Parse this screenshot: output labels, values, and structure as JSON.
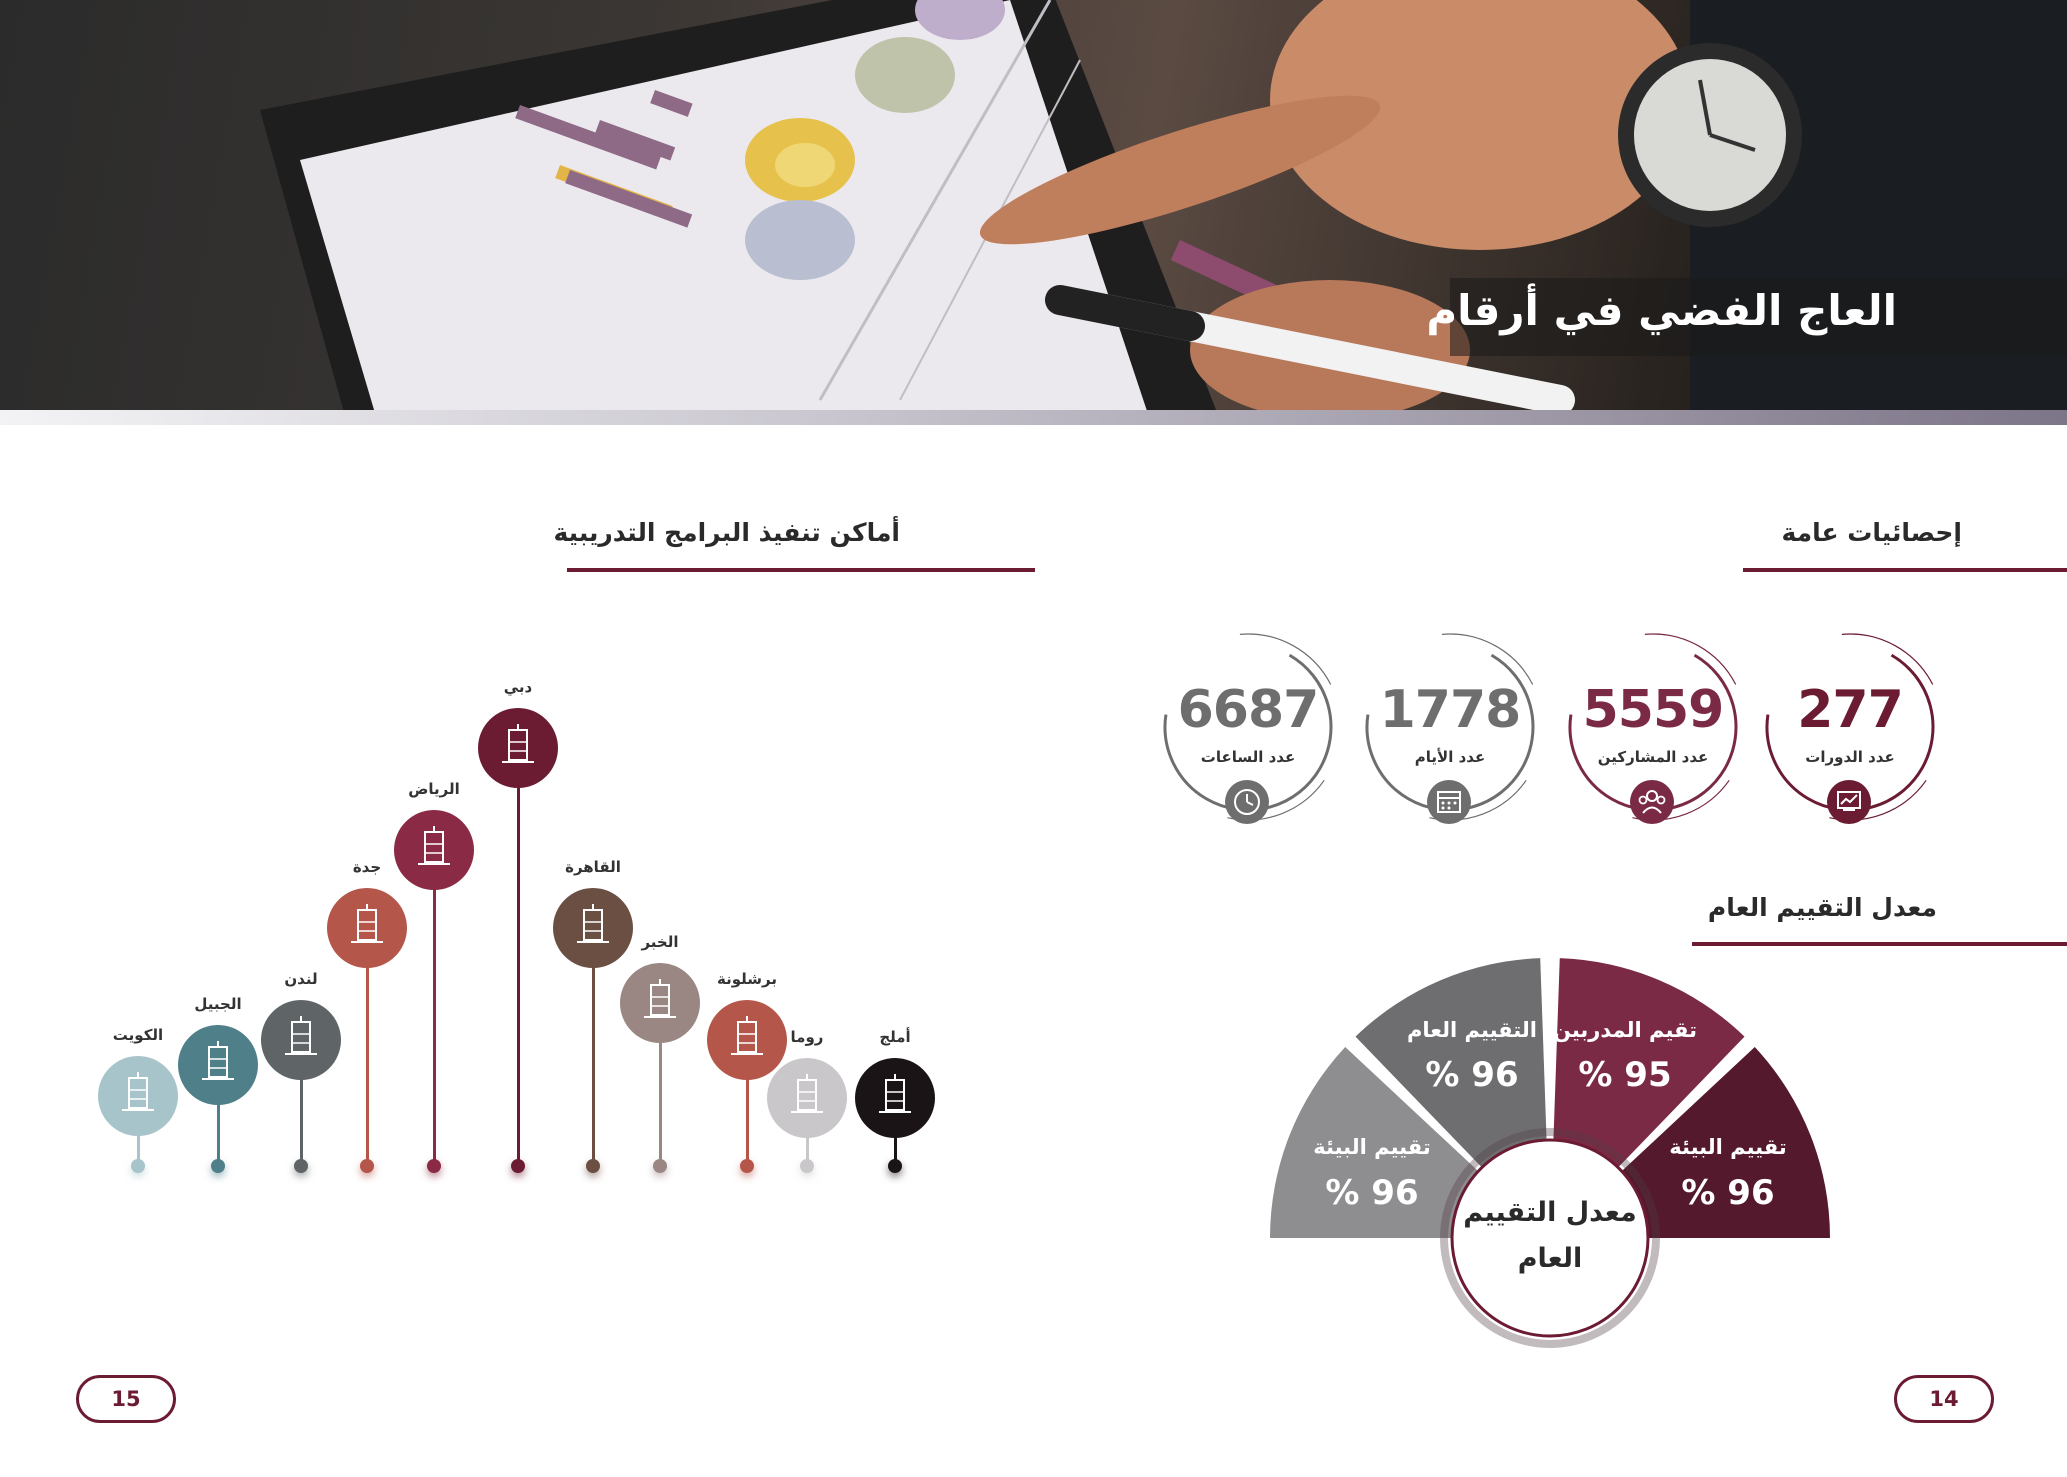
{
  "hero": {
    "title": "العاج الفضي في أرقام"
  },
  "stats_section": {
    "heading": "إحصائيات عامة",
    "items": [
      {
        "value": "277",
        "label": "عدد الدورات",
        "color": "#6b1c32",
        "icon": "chart-board-icon"
      },
      {
        "value": "5559",
        "label": "عدد المشاركين",
        "color": "#7b2a45",
        "icon": "people-icon"
      },
      {
        "value": "1778",
        "label": "عدد الأيام",
        "color": "#6e6e6e",
        "icon": "calendar-icon"
      },
      {
        "value": "6687",
        "label": "عدد الساعات",
        "color": "#6e6e6e",
        "icon": "clock-icon"
      }
    ]
  },
  "rating_section": {
    "heading": "معدل التقييم العام",
    "center_label": "معدل التقييم العام",
    "segments": [
      {
        "label": "تقييم البيئة",
        "value": "% 96",
        "color": "#54192c"
      },
      {
        "label": "تقيم المدربين",
        "value": "% 95",
        "color": "#7b2a45"
      },
      {
        "label": "التقييم العام",
        "value": "% 96",
        "color": "#6e6d70"
      },
      {
        "label": "تقييم البيئة",
        "value": "% 96",
        "color": "#8e8d90"
      }
    ]
  },
  "places_section": {
    "heading": "أماكن تنفيذ البرامج التدريبية",
    "cities": [
      {
        "name": "الكويت",
        "color": "#a7c4cb",
        "icon": "kuwait-towers-icon"
      },
      {
        "name": "الجبيل",
        "color": "#4f7f88",
        "icon": "skyline-icon"
      },
      {
        "name": "لندن",
        "color": "#5f6466",
        "icon": "big-ben-icon"
      },
      {
        "name": "جدة",
        "color": "#b5564b",
        "icon": "jeddah-tower-icon"
      },
      {
        "name": "الرياض",
        "color": "#8a2a44",
        "icon": "riyadh-tower-icon"
      },
      {
        "name": "دبي",
        "color": "#6b1c32",
        "icon": "burj-al-arab-icon"
      },
      {
        "name": "القاهرة",
        "color": "#6c4f43",
        "icon": "cairo-tower-icon"
      },
      {
        "name": "الخبر",
        "color": "#9a8783",
        "icon": "khobar-tower-icon"
      },
      {
        "name": "برشلونة",
        "color": "#b5564b",
        "icon": "sagrada-familia-icon"
      },
      {
        "name": "روما",
        "color": "#c9c7c9",
        "icon": "colosseum-icon"
      },
      {
        "name": "أملج",
        "color": "#1a1416",
        "icon": "palm-tree-icon"
      }
    ]
  },
  "pages": {
    "left": "15",
    "right": "14"
  }
}
